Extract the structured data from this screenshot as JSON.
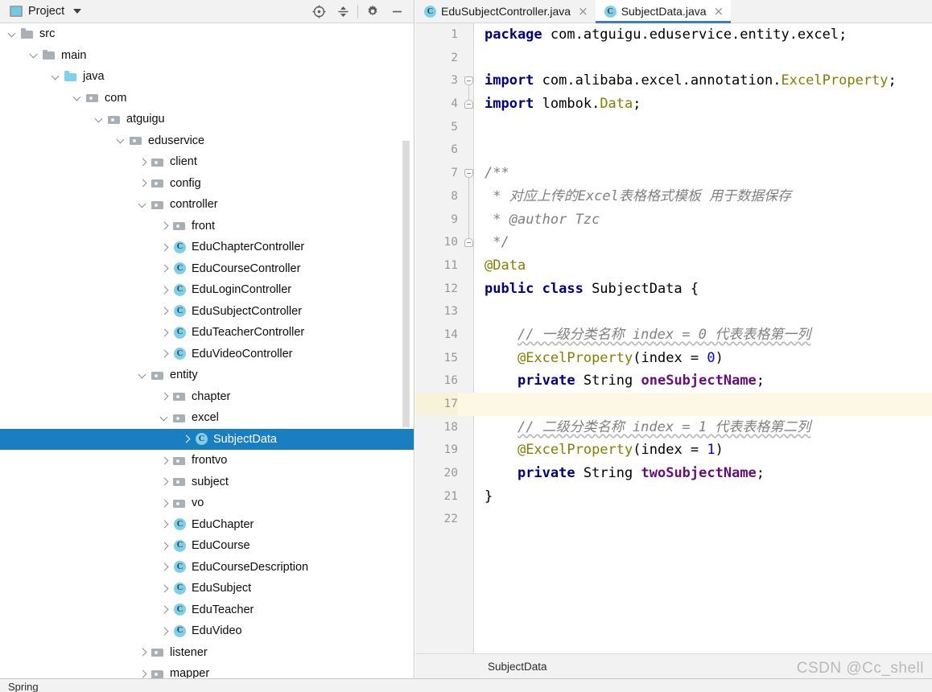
{
  "project_panel": {
    "title": "Project",
    "icon": "project-icon",
    "dropdown_icon": "chevron-down-icon",
    "tools": [
      {
        "name": "locate-icon",
        "glyph": "target"
      },
      {
        "name": "collapse-all-icon",
        "glyph": "collapse"
      },
      {
        "name": "settings-gear-icon",
        "glyph": "gear"
      },
      {
        "name": "hide-panel-icon",
        "glyph": "minus"
      }
    ],
    "tree": [
      {
        "label": "src",
        "depth": 2,
        "kind": "folder",
        "state": "open",
        "selected": false
      },
      {
        "label": "main",
        "depth": 3,
        "kind": "folder",
        "state": "open",
        "selected": false
      },
      {
        "label": "java",
        "depth": 4,
        "kind": "srcfolder",
        "state": "open",
        "selected": false
      },
      {
        "label": "com",
        "depth": 5,
        "kind": "pkg",
        "state": "open",
        "selected": false
      },
      {
        "label": "atguigu",
        "depth": 6,
        "kind": "pkg",
        "state": "open",
        "selected": false
      },
      {
        "label": "eduservice",
        "depth": 7,
        "kind": "pkg",
        "state": "open",
        "selected": false
      },
      {
        "label": "client",
        "depth": 8,
        "kind": "pkg",
        "state": "closed",
        "selected": false
      },
      {
        "label": "config",
        "depth": 8,
        "kind": "pkg",
        "state": "closed",
        "selected": false
      },
      {
        "label": "controller",
        "depth": 8,
        "kind": "pkg",
        "state": "open",
        "selected": false
      },
      {
        "label": "front",
        "depth": 9,
        "kind": "pkg",
        "state": "closed",
        "selected": false
      },
      {
        "label": "EduChapterController",
        "depth": 9,
        "kind": "class",
        "state": "closed",
        "selected": false
      },
      {
        "label": "EduCourseController",
        "depth": 9,
        "kind": "class",
        "state": "closed",
        "selected": false
      },
      {
        "label": "EduLoginController",
        "depth": 9,
        "kind": "class",
        "state": "closed",
        "selected": false
      },
      {
        "label": "EduSubjectController",
        "depth": 9,
        "kind": "class",
        "state": "closed",
        "selected": false
      },
      {
        "label": "EduTeacherController",
        "depth": 9,
        "kind": "class",
        "state": "closed",
        "selected": false
      },
      {
        "label": "EduVideoController",
        "depth": 9,
        "kind": "class",
        "state": "closed",
        "selected": false
      },
      {
        "label": "entity",
        "depth": 8,
        "kind": "pkg",
        "state": "open",
        "selected": false
      },
      {
        "label": "chapter",
        "depth": 9,
        "kind": "pkg",
        "state": "closed",
        "selected": false
      },
      {
        "label": "excel",
        "depth": 9,
        "kind": "pkg",
        "state": "open",
        "selected": false
      },
      {
        "label": "SubjectData",
        "depth": 10,
        "kind": "class",
        "state": "closed",
        "selected": true
      },
      {
        "label": "frontvo",
        "depth": 9,
        "kind": "pkg",
        "state": "closed",
        "selected": false
      },
      {
        "label": "subject",
        "depth": 9,
        "kind": "pkg",
        "state": "closed",
        "selected": false
      },
      {
        "label": "vo",
        "depth": 9,
        "kind": "pkg",
        "state": "closed",
        "selected": false
      },
      {
        "label": "EduChapter",
        "depth": 9,
        "kind": "class",
        "state": "closed",
        "selected": false
      },
      {
        "label": "EduCourse",
        "depth": 9,
        "kind": "class",
        "state": "closed",
        "selected": false
      },
      {
        "label": "EduCourseDescription",
        "depth": 9,
        "kind": "class",
        "state": "closed",
        "selected": false
      },
      {
        "label": "EduSubject",
        "depth": 9,
        "kind": "class",
        "state": "closed",
        "selected": false
      },
      {
        "label": "EduTeacher",
        "depth": 9,
        "kind": "class",
        "state": "closed",
        "selected": false
      },
      {
        "label": "EduVideo",
        "depth": 9,
        "kind": "class",
        "state": "closed",
        "selected": false
      },
      {
        "label": "listener",
        "depth": 8,
        "kind": "pkg",
        "state": "closed",
        "selected": false
      },
      {
        "label": "mapper",
        "depth": 8,
        "kind": "pkg",
        "state": "closed",
        "selected": false
      }
    ]
  },
  "editor": {
    "tabs": [
      {
        "label": "EduSubjectController.java",
        "active": false,
        "icon": "java-class-icon",
        "close_icon": "close-icon"
      },
      {
        "label": "SubjectData.java",
        "active": true,
        "icon": "java-class-icon",
        "close_icon": "close-icon"
      }
    ],
    "current_line": 17,
    "lines": [
      {
        "n": 1,
        "fold": "",
        "tokens": [
          {
            "t": "package ",
            "c": "kw"
          },
          {
            "t": "com.atguigu.eduservice.entity.excel;",
            "c": "pl"
          }
        ]
      },
      {
        "n": 2,
        "fold": "",
        "tokens": []
      },
      {
        "n": 3,
        "fold": "start",
        "tokens": [
          {
            "t": "import ",
            "c": "kw"
          },
          {
            "t": "com.alibaba.excel.annotation.",
            "c": "pl"
          },
          {
            "t": "ExcelProperty",
            "c": "typ"
          },
          {
            "t": ";",
            "c": "pl"
          }
        ]
      },
      {
        "n": 4,
        "fold": "end",
        "tokens": [
          {
            "t": "import ",
            "c": "kw"
          },
          {
            "t": "lombok.",
            "c": "pl"
          },
          {
            "t": "Data",
            "c": "typ"
          },
          {
            "t": ";",
            "c": "pl"
          }
        ]
      },
      {
        "n": 5,
        "fold": "",
        "tokens": []
      },
      {
        "n": 6,
        "fold": "",
        "tokens": []
      },
      {
        "n": 7,
        "fold": "start",
        "tokens": [
          {
            "t": "/**",
            "c": "cmt"
          }
        ]
      },
      {
        "n": 8,
        "fold": "",
        "tokens": [
          {
            "t": " * 对应上传的Excel表格格式模板 用于数据保存",
            "c": "cmt"
          }
        ]
      },
      {
        "n": 9,
        "fold": "",
        "tokens": [
          {
            "t": " * ",
            "c": "cmt"
          },
          {
            "t": "@author",
            "c": "cmt au"
          },
          {
            "t": " Tzc",
            "c": "cmt"
          }
        ]
      },
      {
        "n": 10,
        "fold": "end",
        "tokens": [
          {
            "t": " */",
            "c": "cmt"
          }
        ]
      },
      {
        "n": 11,
        "fold": "",
        "tokens": [
          {
            "t": "@Data",
            "c": "ann"
          }
        ]
      },
      {
        "n": 12,
        "fold": "",
        "tokens": [
          {
            "t": "public class ",
            "c": "kw"
          },
          {
            "t": "SubjectData ",
            "c": "pl"
          },
          {
            "t": "{",
            "c": "pl"
          }
        ]
      },
      {
        "n": 13,
        "fold": "",
        "tokens": []
      },
      {
        "n": 14,
        "fold": "",
        "tokens": [
          {
            "t": "    ",
            "c": "pl"
          },
          {
            "t": "// 一级分类名称 index = 0 代表表格第一列",
            "c": "cmt wavy"
          }
        ]
      },
      {
        "n": 15,
        "fold": "",
        "tokens": [
          {
            "t": "    ",
            "c": "pl"
          },
          {
            "t": "@ExcelProperty",
            "c": "ann"
          },
          {
            "t": "(",
            "c": "pl"
          },
          {
            "t": "index",
            "c": "pl"
          },
          {
            "t": " = ",
            "c": "pl"
          },
          {
            "t": "0",
            "c": "num"
          },
          {
            "t": ")",
            "c": "pl"
          }
        ]
      },
      {
        "n": 16,
        "fold": "",
        "tokens": [
          {
            "t": "    ",
            "c": "pl"
          },
          {
            "t": "private ",
            "c": "kw"
          },
          {
            "t": "String ",
            "c": "pl"
          },
          {
            "t": "oneSubjectName",
            "c": "fld"
          },
          {
            "t": ";",
            "c": "pl"
          }
        ]
      },
      {
        "n": 17,
        "fold": "",
        "tokens": []
      },
      {
        "n": 18,
        "fold": "",
        "tokens": [
          {
            "t": "    ",
            "c": "pl"
          },
          {
            "t": "// 二级分类名称 index = 1 代表表格第二列",
            "c": "cmt wavy"
          }
        ]
      },
      {
        "n": 19,
        "fold": "",
        "tokens": [
          {
            "t": "    ",
            "c": "pl"
          },
          {
            "t": "@ExcelProperty",
            "c": "ann"
          },
          {
            "t": "(",
            "c": "pl"
          },
          {
            "t": "index",
            "c": "pl"
          },
          {
            "t": " = ",
            "c": "pl"
          },
          {
            "t": "1",
            "c": "num"
          },
          {
            "t": ")",
            "c": "pl"
          }
        ]
      },
      {
        "n": 20,
        "fold": "",
        "tokens": [
          {
            "t": "    ",
            "c": "pl"
          },
          {
            "t": "private ",
            "c": "kw"
          },
          {
            "t": "String ",
            "c": "pl"
          },
          {
            "t": "twoSubjectName",
            "c": "fld"
          },
          {
            "t": ";",
            "c": "pl"
          }
        ]
      },
      {
        "n": 21,
        "fold": "",
        "tokens": [
          {
            "t": "}",
            "c": "pl"
          }
        ]
      },
      {
        "n": 22,
        "fold": "",
        "tokens": []
      }
    ],
    "breadcrumb": "SubjectData"
  },
  "watermark": "CSDN @Cc_shell",
  "bottom_strip": "Spring",
  "colors": {
    "selection_blue": "#1a7fc1",
    "tab_underline": "#3a7cc4",
    "caret_line": "#fcf8e3",
    "keyword": "#000080",
    "annotation": "#808000",
    "field": "#660e7a",
    "number": "#0000ff",
    "comment": "#808080",
    "class_icon": "#80cfe8",
    "source_folder": "#7fd2ee"
  }
}
